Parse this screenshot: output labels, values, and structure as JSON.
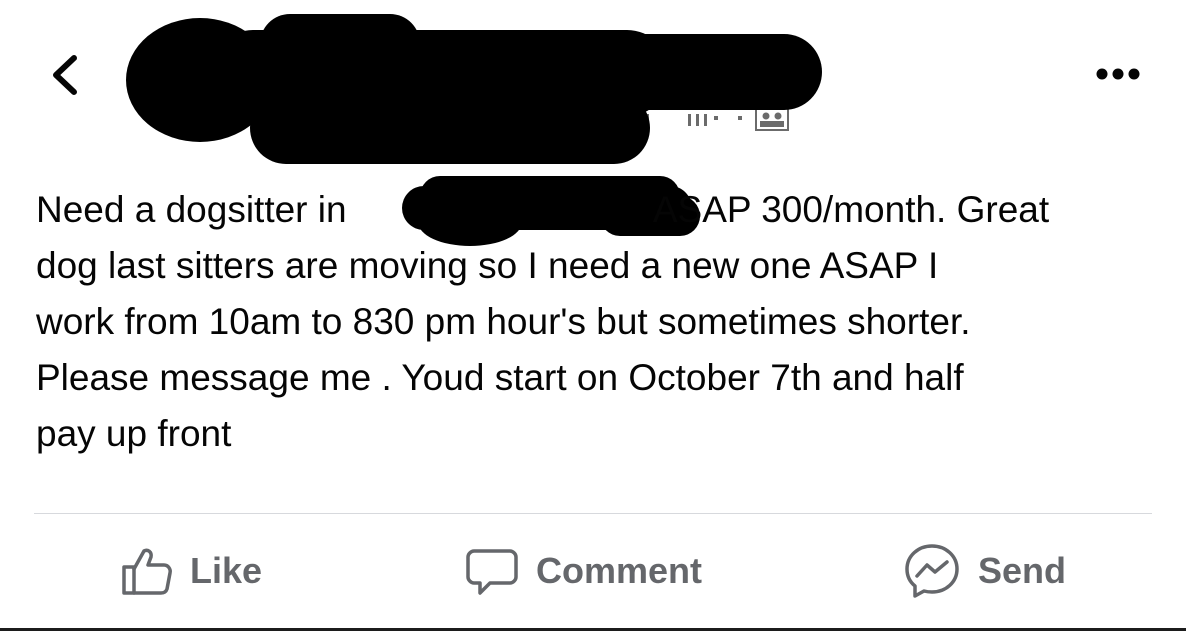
{
  "header": {
    "back_icon": "chevron-left-icon",
    "more_icon": "ellipsis-horizontal-icon",
    "audience_icon": "friends-icon"
  },
  "post": {
    "line_1": "Need a dogsitter in",
    "line_1b": "ASAP 300/month. Great",
    "line_2": "dog last sitters are moving so I need a new one ASAP I",
    "line_3": "work from 10am to 830 pm hour's but sometimes shorter.",
    "line_4": "Please message me . Youd start on October 7th and half",
    "line_5": "pay up front"
  },
  "actions": {
    "like": {
      "label": "Like",
      "icon": "thumbs-up-icon"
    },
    "comment": {
      "label": "Comment",
      "icon": "comment-bubble-icon"
    },
    "send": {
      "label": "Send",
      "icon": "messenger-icon"
    }
  },
  "colors": {
    "text": "#050505",
    "action_gray": "#65676b",
    "divider": "#d7d9dd",
    "redaction": "#000000"
  }
}
